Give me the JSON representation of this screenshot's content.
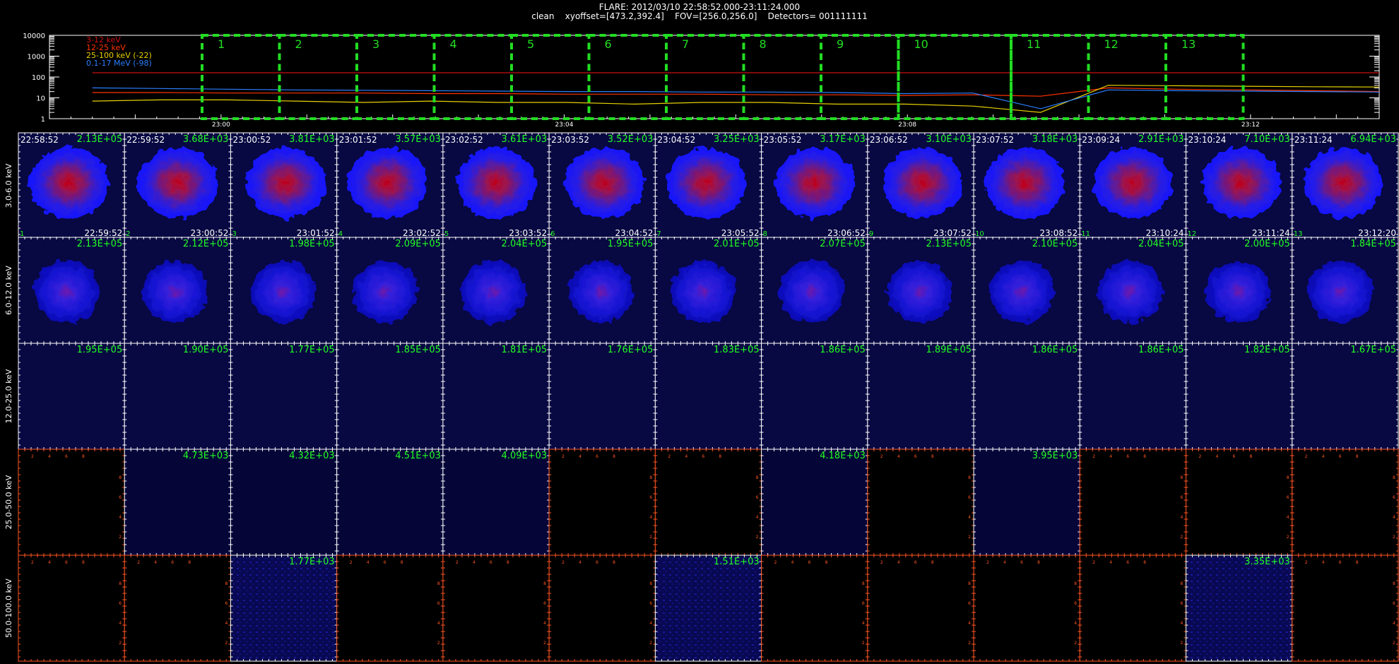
{
  "header": {
    "line1": "FLARE: 2012/03/10 22:58:52.000-23:11:24.000",
    "line2": "clean    xyoffset=[473.2,392.4]    FOV=[256.0,256.0]    Detectors= 001111111"
  },
  "chart_data": [
    {
      "type": "line",
      "yscale": "log",
      "ylim": [
        1,
        10000
      ],
      "yticks": [
        "10000",
        "1000",
        "100",
        "10",
        "1"
      ],
      "xticks": [
        "23:00",
        "23:04",
        "23:08",
        "23:12"
      ],
      "legend": [
        {
          "label": "3-12 keV",
          "color": "#cc1111"
        },
        {
          "label": "12-25 keV",
          "color": "#ff3300"
        },
        {
          "label": "25-100 keV (-22)",
          "color": "#e6d000"
        },
        {
          "label": "0.1-17 MeV (-98)",
          "color": "#2a7fff"
        }
      ],
      "series": [
        {
          "name": "3-12 keV",
          "color": "#cc1111",
          "values": [
            160,
            160,
            160,
            160,
            160,
            160,
            160,
            160,
            160,
            160,
            160,
            160,
            160,
            160,
            160,
            160,
            160,
            160,
            160,
            160
          ]
        },
        {
          "name": "12-25 keV",
          "color": "#ff3300",
          "values": [
            18,
            18,
            17,
            17,
            17,
            16,
            16,
            15,
            15,
            15,
            14,
            14,
            13,
            14,
            12,
            30,
            26,
            24,
            22,
            20
          ]
        },
        {
          "name": "25-100 keV (-22)",
          "color": "#e6d000",
          "values": [
            7,
            8,
            8,
            7,
            6,
            7,
            6,
            6,
            5,
            6,
            6,
            5,
            5,
            4,
            2,
            40,
            38,
            36,
            34,
            33
          ]
        },
        {
          "name": "0.1-17 MeV (-98)",
          "color": "#2a7fff",
          "values": [
            30,
            28,
            26,
            24,
            23,
            22,
            21,
            20,
            20,
            19,
            19,
            18,
            16,
            17,
            3,
            24,
            22,
            21,
            20,
            19
          ]
        }
      ],
      "intervals": [
        "1",
        "2",
        "3",
        "4",
        "5",
        "6",
        "7",
        "8",
        "9",
        "10",
        "11",
        "12",
        "13"
      ]
    },
    {
      "type": "heatmap",
      "row_labels": [
        "3.0-6.0 keV",
        "6.0-12.0 keV",
        "12.0-25.0 keV",
        "25.0-50.0 keV",
        "50.0-100.0 keV"
      ],
      "start_times": [
        "22:58:52",
        "22:59:52",
        "23:00:52",
        "23:01:52",
        "23:02:52",
        "23:03:52",
        "23:04:52",
        "23:05:52",
        "23:06:52",
        "23:07:52",
        "23:09:24",
        "23:10:24",
        "23:11:24"
      ],
      "end_times": [
        "22:59:52",
        "23:00:52",
        "23:01:52",
        "23:02:52",
        "23:03:52",
        "23:04:52",
        "23:05:52",
        "23:06:52",
        "23:07:52",
        "23:08:52",
        "23:10:24",
        "23:11:24",
        "23:12:20"
      ],
      "intervals": [
        "1",
        "2",
        "3",
        "4",
        "5",
        "6",
        "7",
        "8",
        "9",
        "10",
        "11",
        "12",
        "13"
      ],
      "max_values": [
        [
          "2.13E+05",
          "3.68E+03",
          "3.81E+03",
          "3.57E+03",
          "3.61E+03",
          "3.52E+03",
          "3.25E+03",
          "3.17E+03",
          "3.10E+03",
          "3.18E+03",
          "2.91E+03",
          "7.10E+03",
          "6.94E+03"
        ],
        [
          "2.13E+05",
          "2.12E+05",
          "1.98E+05",
          "2.09E+05",
          "2.04E+05",
          "1.95E+05",
          "2.01E+05",
          "2.07E+05",
          "2.13E+05",
          "2.10E+05",
          "2.04E+05",
          "2.00E+05",
          "1.84E+05"
        ],
        [
          "1.95E+05",
          "1.90E+05",
          "1.77E+05",
          "1.85E+05",
          "1.81E+05",
          "1.76E+05",
          "1.83E+05",
          "1.86E+05",
          "1.89E+05",
          "1.86E+05",
          "1.86E+05",
          "1.82E+05",
          "1.67E+05"
        ],
        [
          "",
          "4.73E+03",
          "4.32E+03",
          "4.51E+03",
          "4.09E+03",
          "",
          "",
          "4.18E+03",
          "",
          "3.95E+03",
          "",
          "",
          ""
        ],
        [
          "",
          "",
          "1.77E+03",
          "",
          "",
          "",
          "1.51E+03",
          "",
          "",
          "",
          "",
          "3.35E+03",
          ""
        ]
      ],
      "colormap": "rainbow-dark"
    }
  ]
}
